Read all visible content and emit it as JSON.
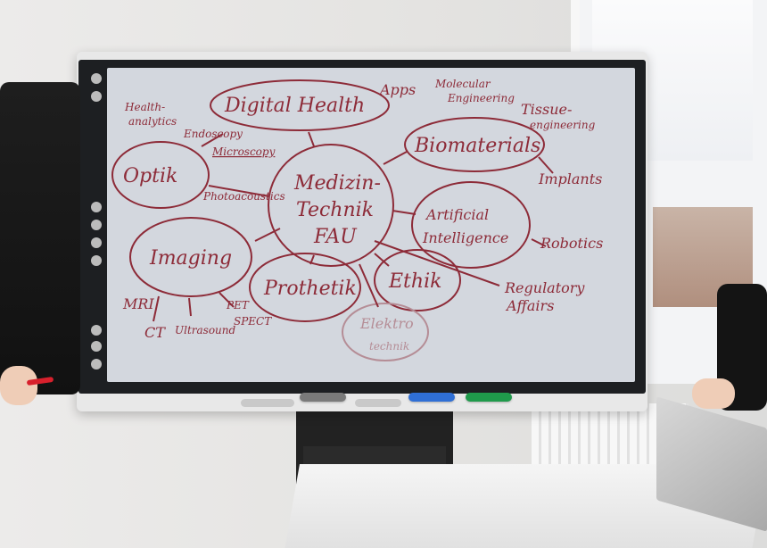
{
  "board": {
    "center": {
      "line1": "Medizin-",
      "line2": "Technik",
      "line3": "FAU"
    },
    "nodes": {
      "digital_health": "Digital Health",
      "biomaterials": "Biomaterials",
      "optik": "Optik",
      "imaging": "Imaging",
      "artificial_intelligence_1": "Artificial",
      "artificial_intelligence_2": "Intelligence",
      "prothetik": "Prothetik",
      "ethik": "Ethik",
      "elektrotechnik_1": "Elektro",
      "elektrotechnik_2": "technik"
    },
    "labels": {
      "health_analytics_1": "Health-",
      "health_analytics_2": "analytics",
      "apps": "Apps",
      "molecular_1": "Molecular",
      "molecular_2": "Engineering",
      "tissue_1": "Tissue-",
      "tissue_2": "engineering",
      "implants": "Implants",
      "endoscopy": "Endoscopy",
      "microscopy": "Microscopy",
      "photoacoustics": "Photoacoustics",
      "robotics": "Robotics",
      "regulatory_1": "Regulatory",
      "regulatory_2": "Affairs",
      "mri": "MRI",
      "ct": "CT",
      "ultrasound": "Ultrasound",
      "pet": "PET",
      "spect": "SPECT"
    }
  },
  "colors": {
    "ink": "#8d2b38",
    "screen": "#d3d7de",
    "bezel": "#1d1f22"
  },
  "icons": {
    "toolbar": [
      "back-icon",
      "pen-icon",
      "select-icon",
      "grid-icon",
      "apps-icon",
      "home-icon"
    ]
  }
}
